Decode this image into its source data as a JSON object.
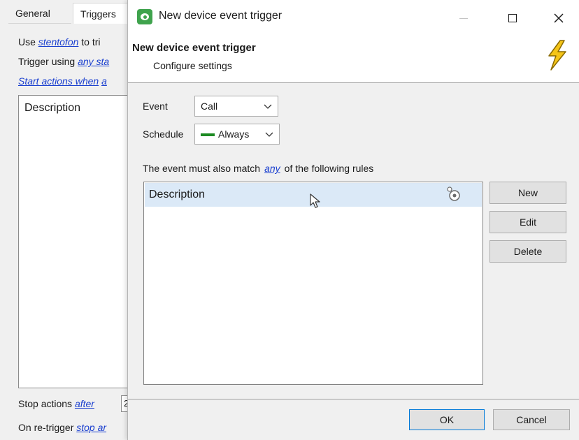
{
  "background_window": {
    "tabs": [
      "General",
      "Triggers"
    ],
    "line1_prefix": "Use",
    "line1_link": "stentofon",
    "line1_suffix": "to tri",
    "line2_prefix": "Trigger using",
    "line2_link": "any sta",
    "line3_link": "Start actions when",
    "line3_link2": "a",
    "description_label": "Description",
    "stop_prefix": "Stop actions",
    "stop_link": "after",
    "stop_value": "2",
    "retrigger_prefix": "On re-trigger",
    "retrigger_link": "stop ar"
  },
  "dialog": {
    "title": "New device event trigger",
    "header_title": "New device event trigger",
    "header_subtitle": "Configure settings",
    "event_label": "Event",
    "event_value": "Call",
    "schedule_label": "Schedule",
    "schedule_value": "Always",
    "schedule_color": "#1c8a22",
    "rules_prefix": "The event must also match",
    "rules_link": "any",
    "rules_suffix": "of the following rules",
    "rules_column_header": "Description",
    "buttons": {
      "new": "New",
      "edit": "Edit",
      "delete": "Delete"
    },
    "ok": "OK",
    "cancel": "Cancel"
  },
  "colors": {
    "link": "#1a3fcf",
    "selection": "#dbe9f7",
    "bolt": "#f5c518",
    "app_icon": "#3fa34d"
  }
}
